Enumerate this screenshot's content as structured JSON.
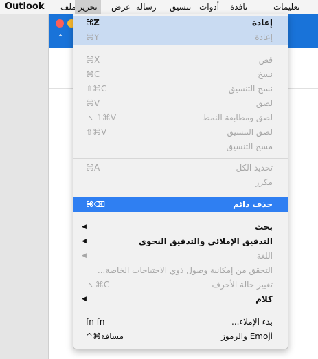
{
  "menubar": {
    "items": [
      {
        "label": "Outlook"
      },
      {
        "label": "ملف"
      },
      {
        "label": "تحرير"
      },
      {
        "label": "عرض"
      },
      {
        "label": "رسالة"
      },
      {
        "label": "تنسيق"
      },
      {
        "label": "أدوات"
      },
      {
        "label": "نافذة"
      },
      {
        "label": "تعليمات"
      }
    ]
  },
  "edit_menu": {
    "items": [
      {
        "label": "إعادة",
        "shortcut": "⌘Z"
      },
      {
        "label": "إعادة",
        "shortcut": "⌘Y"
      },
      {
        "label": "قص",
        "shortcut": "⌘X"
      },
      {
        "label": "نسخ",
        "shortcut": "⌘C"
      },
      {
        "label": "نسخ التنسيق",
        "shortcut": "⇧⌘C"
      },
      {
        "label": "لصق",
        "shortcut": "⌘V"
      },
      {
        "label": "لصق ومطابقة النمط",
        "shortcut": "⌥⇧⌘V"
      },
      {
        "label": "لصق التنسيق",
        "shortcut": "⇧⌘V"
      },
      {
        "label": "مسح التنسيق",
        "shortcut": ""
      },
      {
        "label": "تحديد الكل",
        "shortcut": "⌘A"
      },
      {
        "label": "مكرر",
        "shortcut": ""
      },
      {
        "label": "حذف دائم",
        "shortcut": "⌘⌫"
      },
      {
        "label": "بحث",
        "shortcut": ""
      },
      {
        "label": "التدقيق الإملائي والتدقيق النحوي",
        "shortcut": ""
      },
      {
        "label": "اللغة",
        "shortcut": ""
      },
      {
        "label": "التحقق من إمكانية وصول ذوي الاحتياجات الخاصة...",
        "shortcut": ""
      },
      {
        "label": "تغيير حالة الأحرف",
        "shortcut": "⌥⌘C"
      },
      {
        "label": "كلام",
        "shortcut": ""
      },
      {
        "label": "بدء الإملاء...",
        "shortcut": "fn fn"
      },
      {
        "label": "Emoji والرموز",
        "shortcut": "^⌘مسافة"
      }
    ],
    "submenu_arrow": "◀"
  },
  "colors": {
    "titlebar": "#1973d9",
    "highlight": "#2f7ff2",
    "highlight_light": "#c9dbf2"
  }
}
